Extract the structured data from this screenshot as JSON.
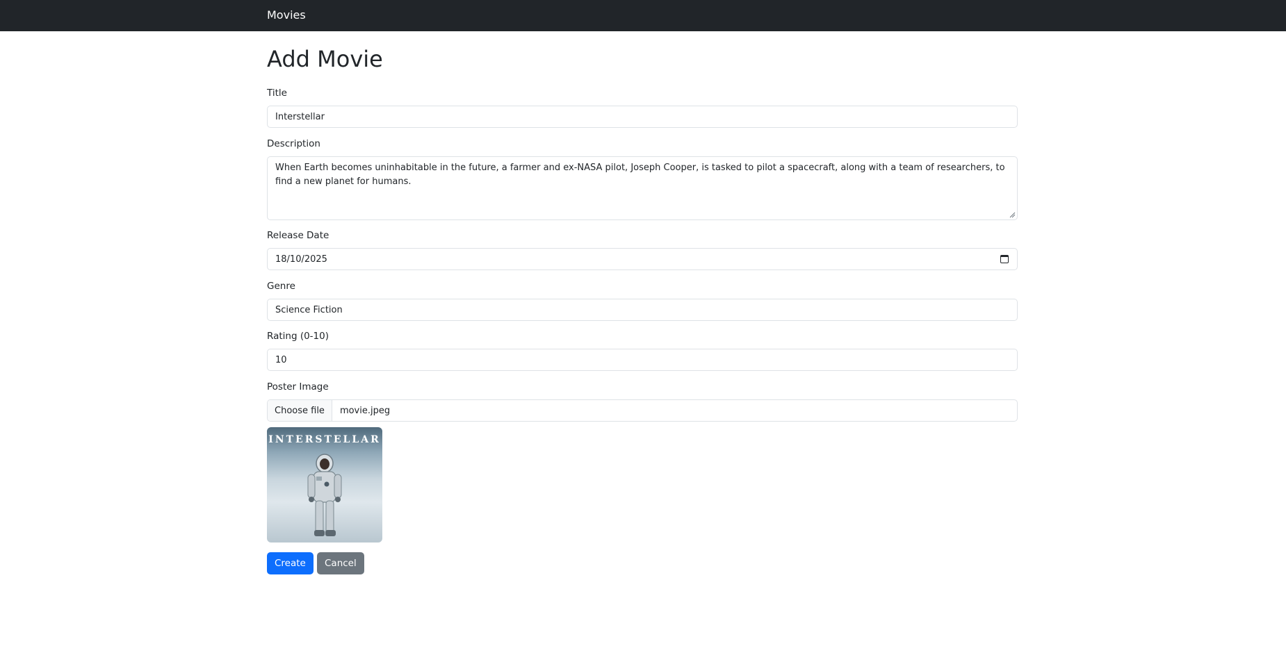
{
  "navbar": {
    "brand": "Movies"
  },
  "page": {
    "title": "Add Movie"
  },
  "form": {
    "title": {
      "label": "Title",
      "value": "Interstellar"
    },
    "description": {
      "label": "Description",
      "value": "When Earth becomes uninhabitable in the future, a farmer and ex-NASA pilot, Joseph Cooper, is tasked to pilot a spacecraft, along with a team of researchers, to find a new planet for humans."
    },
    "release_date": {
      "label": "Release Date",
      "value": "18/10/2025",
      "icon": "calendar-icon"
    },
    "genre": {
      "label": "Genre",
      "value": "Science Fiction"
    },
    "rating": {
      "label": "Rating (0-10)",
      "value": "10"
    },
    "poster": {
      "label": "Poster Image",
      "button_label": "Choose file",
      "file_name": "movie.jpeg",
      "preview_text": "INTERSTELLAR"
    }
  },
  "actions": {
    "create_label": "Create",
    "cancel_label": "Cancel"
  },
  "colors": {
    "navbar_bg": "#212529",
    "primary": "#0d6efd",
    "secondary": "#6c757d",
    "border": "#dee2e6"
  }
}
